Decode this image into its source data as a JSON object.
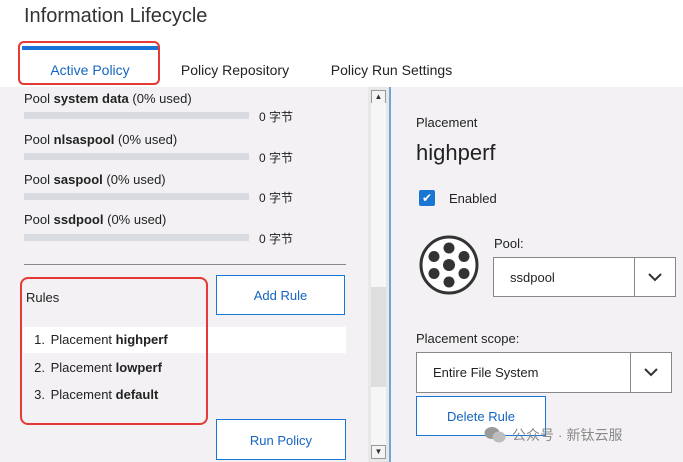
{
  "window": {
    "title": "Information Lifecycle"
  },
  "tabs": [
    {
      "label": "Active Policy",
      "active": true
    },
    {
      "label": "Policy Repository",
      "active": false
    },
    {
      "label": "Policy Run Settings",
      "active": false
    }
  ],
  "pools": [
    {
      "prefix": "Pool ",
      "name": "system data",
      "usage": "(0% used)",
      "bytes": "0 字节",
      "used_fraction": 0
    },
    {
      "prefix": "Pool ",
      "name": "nlsaspool",
      "usage": "(0% used)",
      "bytes": "0 字节",
      "used_fraction": 0
    },
    {
      "prefix": "Pool ",
      "name": "saspool",
      "usage": "(0% used)",
      "bytes": "0 字节",
      "used_fraction": 0
    },
    {
      "prefix": "Pool ",
      "name": "ssdpool",
      "usage": "(0% used)",
      "bytes": "0 字节",
      "used_fraction": 0
    }
  ],
  "rules": {
    "label": "Rules",
    "add_label": "Add Rule",
    "run_label": "Run Policy",
    "items": [
      {
        "num": "1.",
        "prefix": "Placement ",
        "name": "highperf",
        "selected": true
      },
      {
        "num": "2.",
        "prefix": "Placement ",
        "name": "lowperf",
        "selected": false
      },
      {
        "num": "3.",
        "prefix": "Placement ",
        "name": "default",
        "selected": false
      }
    ]
  },
  "detail": {
    "type_label": "Placement",
    "name": "highperf",
    "enabled_label": "Enabled",
    "enabled": true,
    "pool_label": "Pool:",
    "pool_value": "ssdpool",
    "scope_label": "Placement scope:",
    "scope_value": "Entire File System",
    "delete_label": "Delete Rule"
  },
  "watermark": {
    "text": "公众号 · 新钛云服"
  },
  "icons": {
    "scroll_up": "arrow-up-icon",
    "scroll_down": "arrow-down-icon",
    "checkbox": "checkmark-icon",
    "pool": "disk-pool-icon",
    "dropdown": "chevron-down-icon"
  },
  "colors": {
    "accent": "#1976d2",
    "highlight": "#e53935",
    "panel": "#f3f1f4"
  }
}
